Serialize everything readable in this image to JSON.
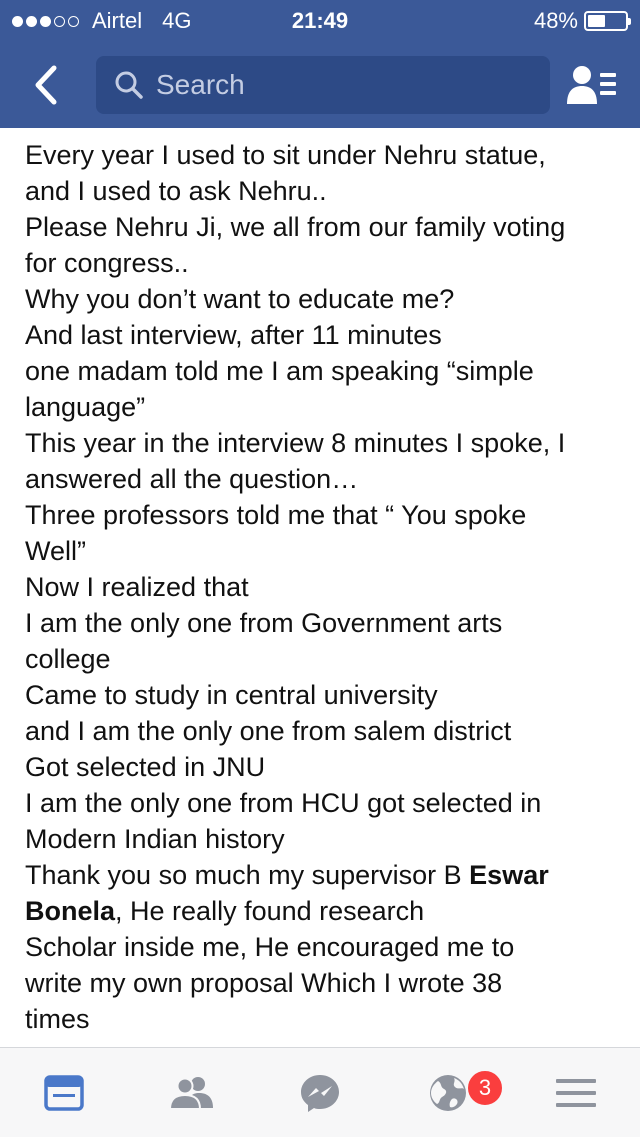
{
  "status_bar": {
    "carrier": "Airtel",
    "network": "4G",
    "time": "21:49",
    "battery_percent": "48%",
    "signal_bars_filled": 3,
    "signal_bars_total": 5,
    "battery_level": 0.48
  },
  "nav": {
    "back_icon": "chevron-left-icon",
    "search_placeholder": "Search",
    "friends_icon": "friend-requests-icon"
  },
  "post": {
    "lines": [
      "Every year I used to sit under Nehru statue,",
      "and I used to ask Nehru..",
      "Please Nehru Ji, we all from our family voting",
      "for congress..",
      "Why  you  don’t want to educate me?",
      "And last interview, after 11 minutes",
      " one madam told me I am speaking “simple",
      "language”",
      "This year in the interview 8 minutes I spoke, I",
      "answered all the question…",
      "Three professors told me that “ You spoke",
      "Well”",
      "Now I realized that",
      "I am the only one from Government arts",
      "college",
      "Came to study in central university",
      "and I am the only one from salem district",
      "Got selected in JNU",
      "I am the only one from HCU got selected in",
      "Modern Indian history"
    ],
    "thanks_line_prefix": "Thank you so much my supervisor B ",
    "thanks_line_bold": "Eswar",
    "bonela_bold": "Bonela",
    "bonela_rest": ", He really found research",
    "lines_after": [
      "Scholar inside me, He encouraged me to",
      "write my own proposal Which I wrote 38",
      "times"
    ]
  },
  "tab_bar": {
    "tabs": [
      "news-feed-icon",
      "friends-icon",
      "messenger-icon",
      "notifications-globe-icon",
      "menu-icon"
    ],
    "active_tab": "news-feed-icon",
    "notification_count": "3",
    "active_color": "#4a78c9",
    "inactive_color": "#8f949e"
  },
  "colors": {
    "brand": "#3b5998",
    "badge": "#fa3e3e"
  }
}
